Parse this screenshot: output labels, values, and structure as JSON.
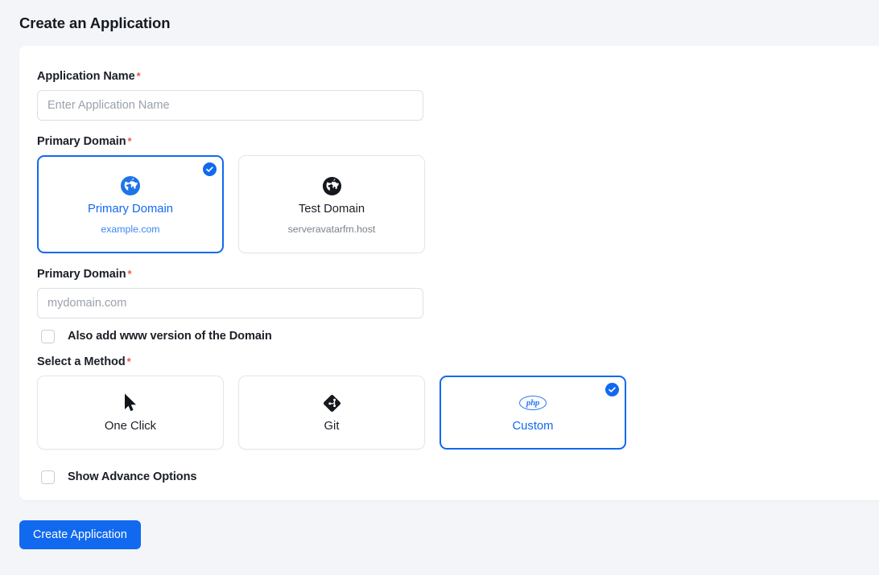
{
  "header": {
    "title": "Create an Application"
  },
  "form": {
    "app_name": {
      "label": "Application Name",
      "required_mark": "*",
      "placeholder": "Enter Application Name",
      "value": ""
    },
    "domain_type": {
      "label": "Primary Domain",
      "required_mark": "*",
      "options": [
        {
          "id": "primary-domain",
          "icon": "globe-icon",
          "title": "Primary Domain",
          "subtitle": "example.com",
          "selected": true
        },
        {
          "id": "test-domain",
          "icon": "globe-icon",
          "title": "Test Domain",
          "subtitle": "serveravatarfm.host",
          "selected": false
        }
      ]
    },
    "primary_domain": {
      "label": "Primary Domain",
      "required_mark": "*",
      "placeholder": "mydomain.com",
      "value": ""
    },
    "www_checkbox": {
      "label": "Also add www version of the Domain",
      "checked": false
    },
    "method": {
      "label": "Select a Method",
      "required_mark": "*",
      "options": [
        {
          "id": "one-click",
          "icon": "cursor-icon",
          "title": "One Click",
          "selected": false
        },
        {
          "id": "git",
          "icon": "git-icon",
          "title": "Git",
          "selected": false
        },
        {
          "id": "custom",
          "icon": "php-icon",
          "title": "Custom",
          "selected": true
        }
      ]
    },
    "advance_checkbox": {
      "label": "Show Advance Options",
      "checked": false
    }
  },
  "footer": {
    "submit_label": "Create Application"
  },
  "colors": {
    "accent": "#1169ef",
    "page_bg": "#f4f5f9",
    "panel_bg": "#ffffff",
    "required": "#f0564a",
    "muted_text": "#7a828d"
  }
}
